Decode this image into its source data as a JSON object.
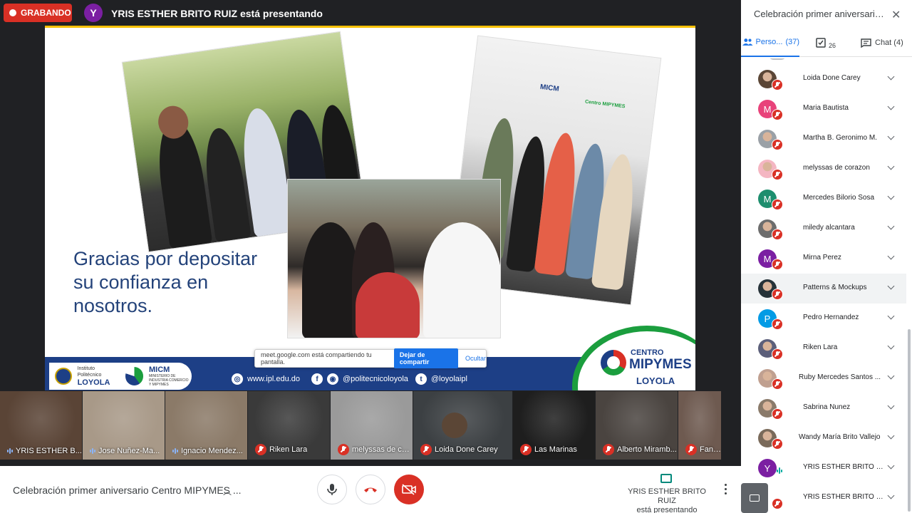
{
  "topbar": {
    "recording_label": "GRABANDO",
    "presenter_initial": "Y",
    "presenter_text": "YRIS ESTHER BRITO RUIZ está presentando"
  },
  "slide": {
    "text": "Gracias por depositar su confianza en nosotros.",
    "logos": {
      "loyola_small": "Instituto Politécnico",
      "loyola_name": "LOYOLA",
      "micm_name": "MICM",
      "micm_sub": "MINISTERIO DE INDUSTRIA COMERCIO Y MIPYMES"
    },
    "links": {
      "web": "www.ipl.edu.do",
      "social": "@politecnicoloyola",
      "twitter": "@loyolaipl"
    },
    "brand": {
      "centro": "CENTRO",
      "mipymes": "MIPYMES",
      "loyola": "LOYOLA"
    },
    "photo_sign": {
      "left": "MICM",
      "right": "Centro MIPYMES"
    }
  },
  "share_bar": {
    "message": "meet.google.com está compartiendo tu pantalla.",
    "stop_label": "Dejar de compartir",
    "hide_label": "Ocultar"
  },
  "filmstrip": [
    {
      "name": "YRIS ESTHER B...",
      "state": "speaking",
      "bg": "#5a4436"
    },
    {
      "name": "Jose Nuñez-Ma...",
      "state": "speaking",
      "bg": "#a89988"
    },
    {
      "name": "Ignacio Mendez...",
      "state": "speaking",
      "bg": "#8b7a68"
    },
    {
      "name": "Riken Lara",
      "state": "muted",
      "bg": "#3a3a3a"
    },
    {
      "name": "melyssas de cor...",
      "state": "muted",
      "bg": "#9a9a9a"
    },
    {
      "name": "Loida Done Carey",
      "state": "muted",
      "bg": "#3c4043"
    },
    {
      "name": "Las Marinas",
      "state": "muted",
      "bg": "#1e1e1e"
    },
    {
      "name": "Alberto Miramb...",
      "state": "muted",
      "bg": "#4a4440"
    },
    {
      "name": "Fanny Valdez",
      "state": "muted",
      "bg": "#6e5a50"
    }
  ],
  "controls": {
    "meeting_title": "Celebración primer aniversario Centro MIPYMES ...",
    "presenting_name": "YRIS ESTHER BRITO RUIZ",
    "presenting_status": "está presentando"
  },
  "sidebar": {
    "title": "Celebración primer aniversario ...",
    "tabs": {
      "people_label": "Perso...",
      "people_count": "(37)",
      "activities_count": "26",
      "chat_label": "Chat (4)"
    },
    "participants": [
      {
        "name": "Loida Done Carey",
        "avatar": "photo",
        "color": "#5b4636",
        "mic": "muted"
      },
      {
        "name": "Maria Bautista",
        "avatar": "letter",
        "letter": "M",
        "color": "#e8437a",
        "mic": "muted"
      },
      {
        "name": "Martha B. Geronimo M.",
        "avatar": "photo",
        "color": "#9aa0a6",
        "mic": "muted"
      },
      {
        "name": "melyssas de corazon",
        "avatar": "photo",
        "color": "#f4b6c2",
        "mic": "muted"
      },
      {
        "name": "Mercedes Bilorio Sosa",
        "avatar": "letter",
        "letter": "M",
        "color": "#1e8e6e",
        "mic": "muted"
      },
      {
        "name": "miledy alcantara",
        "avatar": "photo",
        "color": "#6d6d6d",
        "mic": "muted"
      },
      {
        "name": "Mirna Perez",
        "avatar": "letter",
        "letter": "M",
        "color": "#7b1fa2",
        "mic": "muted"
      },
      {
        "name": "Patterns & Mockups",
        "avatar": "photo",
        "color": "#263238",
        "mic": "muted"
      },
      {
        "name": "Pedro Hernandez",
        "avatar": "letter",
        "letter": "P",
        "color": "#039be5",
        "mic": "muted"
      },
      {
        "name": "Riken Lara",
        "avatar": "photo",
        "color": "#5c5f7a",
        "mic": "muted"
      },
      {
        "name": "Ruby Mercedes Santos ...",
        "avatar": "photo",
        "color": "#c0a090",
        "mic": "muted"
      },
      {
        "name": "Sabrina Nunez",
        "avatar": "photo",
        "color": "#8a7a6a",
        "mic": "muted"
      },
      {
        "name": "Wandy María Brito Vallejo",
        "avatar": "photo",
        "color": "#7a6a5a",
        "mic": "muted"
      },
      {
        "name": "YRIS ESTHER BRITO RUIZ",
        "avatar": "letter",
        "letter": "Y",
        "color": "#7b1fa2",
        "mic": "speaking"
      },
      {
        "name": "YRIS ESTHER BRITO RU...",
        "avatar": "present",
        "color": "#5f6368",
        "mic": "muted"
      }
    ]
  }
}
